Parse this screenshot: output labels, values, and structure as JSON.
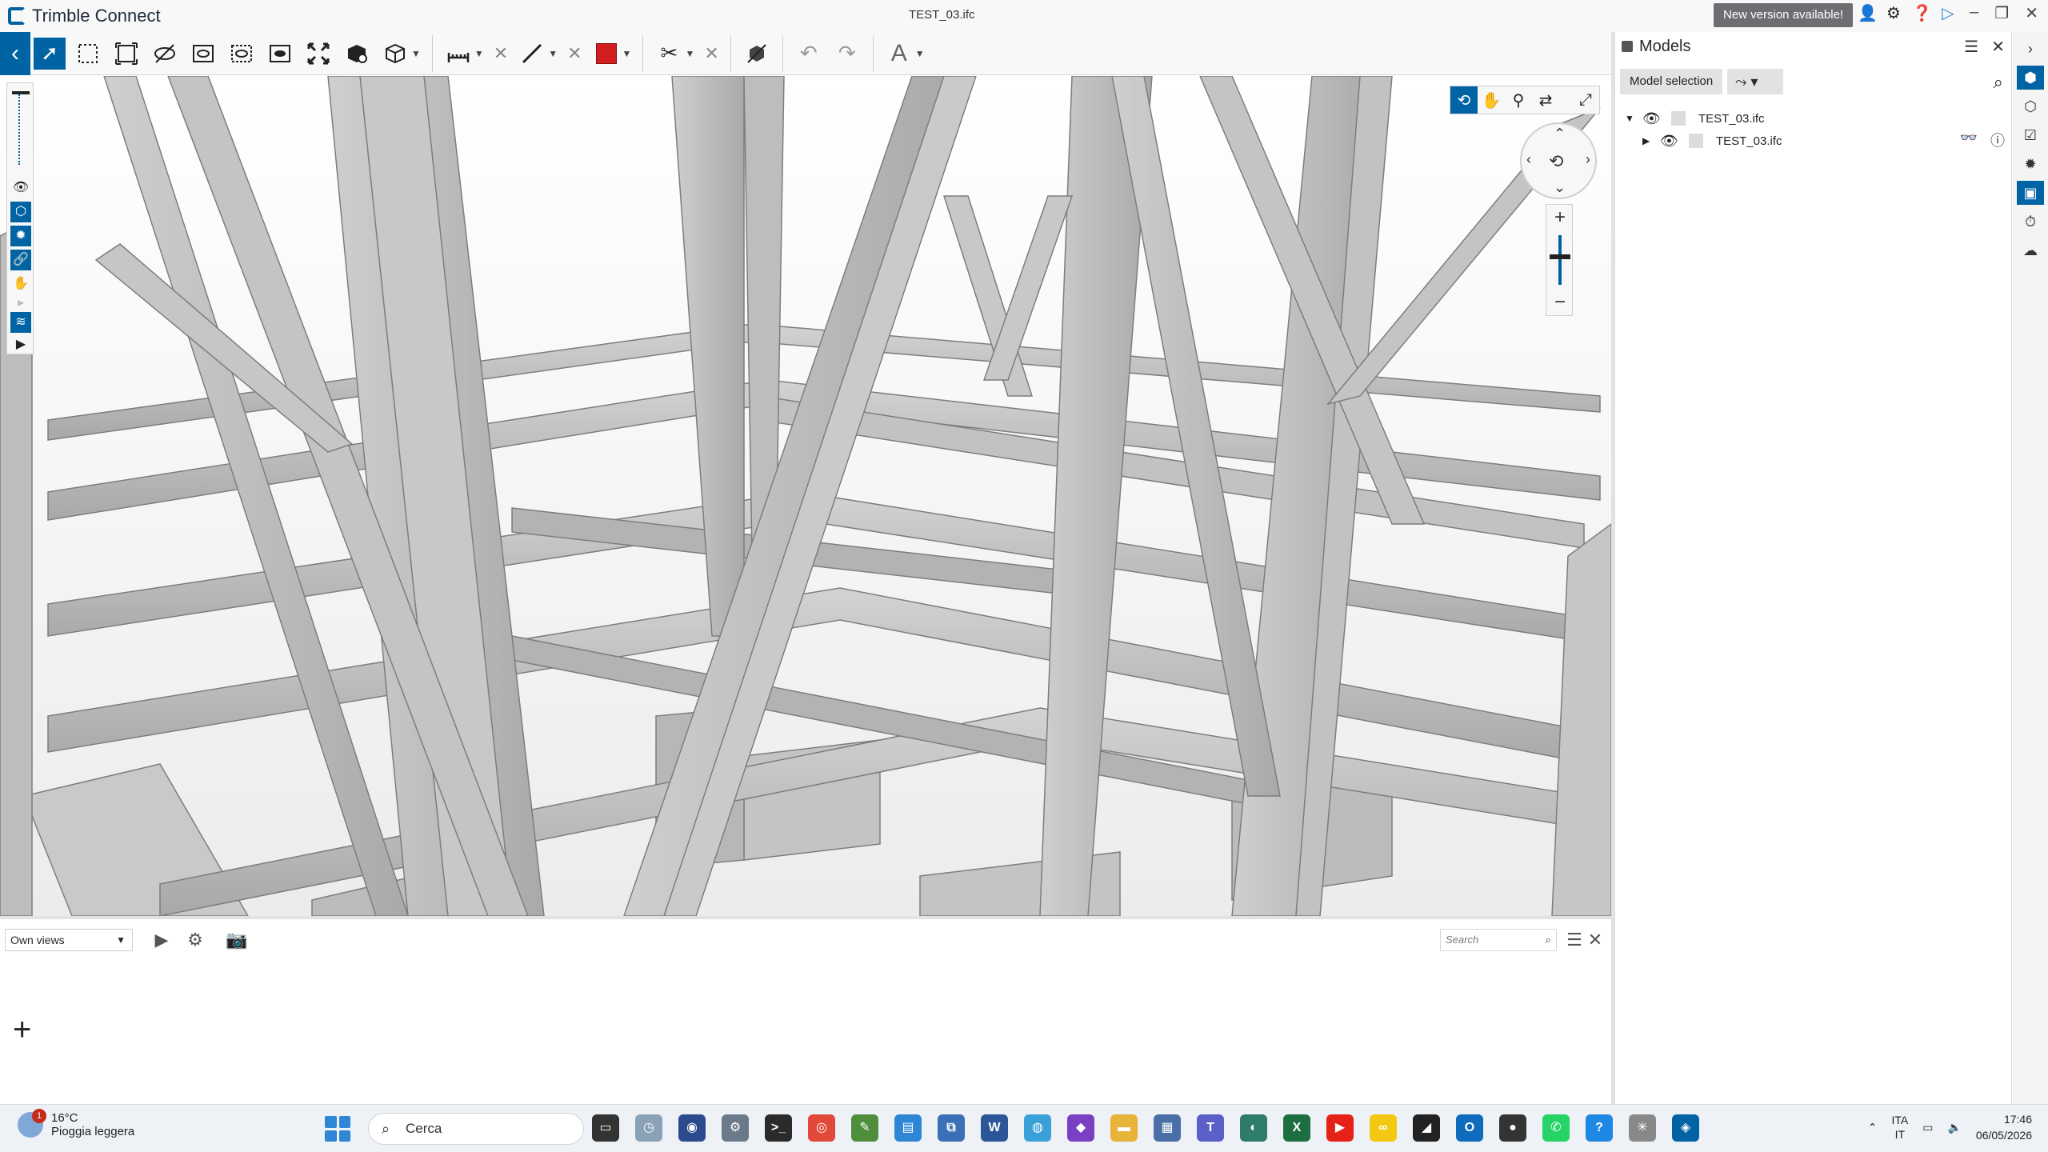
{
  "window": {
    "brand": "Trimble Connect",
    "doc_title": "TEST_03.ifc",
    "new_version": "New version available!"
  },
  "toolbar": {
    "items": [
      "back",
      "select",
      "box-select",
      "fit-selection",
      "hide",
      "section",
      "section-box",
      "section-plane",
      "fit-all",
      "object-props",
      "cube-view",
      "measure",
      "markup-line",
      "markup-color",
      "clip",
      "clear-tools",
      "undo",
      "redo",
      "text"
    ]
  },
  "right_panel": {
    "title": "Models",
    "model_selection": "Model selection",
    "tree": [
      {
        "name": "TEST_03.ifc",
        "expanded": true,
        "level": 0
      },
      {
        "name": "TEST_03.ifc",
        "expanded": false,
        "level": 1
      }
    ]
  },
  "bottom_panel": {
    "views_select": "Own views",
    "search_placeholder": "Search"
  },
  "taskbar": {
    "weather_temp": "16°C",
    "weather_desc": "Pioggia leggera",
    "weather_badge": "1",
    "search": "Cerca",
    "lang_top": "ITA",
    "lang_bottom": "IT",
    "time": "17:46",
    "date": "06/05/2026"
  },
  "colors": {
    "accent": "#0063a3",
    "markup": "#d11f1f",
    "new_version_bg": "#6d6e71"
  }
}
